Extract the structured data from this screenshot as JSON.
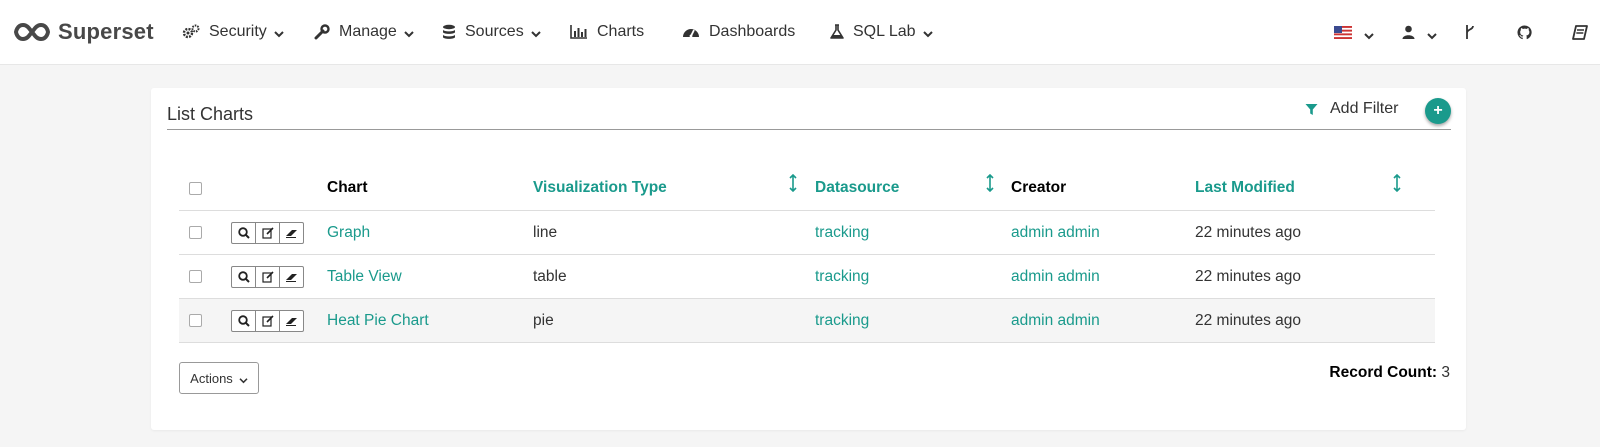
{
  "brand": {
    "name": "Superset"
  },
  "nav": {
    "items": [
      {
        "label": "Security",
        "icon": "gears-icon",
        "dropdown": true
      },
      {
        "label": "Manage",
        "icon": "wrench-icon",
        "dropdown": true
      },
      {
        "label": "Sources",
        "icon": "database-icon",
        "dropdown": true
      },
      {
        "label": "Charts",
        "icon": "bar-chart-icon",
        "dropdown": false
      },
      {
        "label": "Dashboards",
        "icon": "dashboard-icon",
        "dropdown": false
      },
      {
        "label": "SQL Lab",
        "icon": "flask-icon",
        "dropdown": true
      }
    ],
    "right": [
      "us-flag-icon",
      "user-icon",
      "version-icon",
      "github-icon",
      "book-icon"
    ]
  },
  "panel": {
    "title": "List Charts",
    "add_filter": "Add Filter",
    "add_symbol": "+"
  },
  "table": {
    "columns": {
      "chart": "Chart",
      "viz_type": "Visualization Type",
      "datasource": "Datasource",
      "creator": "Creator",
      "modified": "Last Modified"
    },
    "rows": [
      {
        "chart": "Graph",
        "viz_type": "line",
        "datasource": "tracking",
        "creator": "admin admin",
        "modified": "22 minutes ago"
      },
      {
        "chart": "Table View",
        "viz_type": "table",
        "datasource": "tracking",
        "creator": "admin admin",
        "modified": "22 minutes ago"
      },
      {
        "chart": "Heat Pie Chart",
        "viz_type": "pie",
        "datasource": "tracking",
        "creator": "admin admin",
        "modified": "22 minutes ago"
      }
    ]
  },
  "footer": {
    "actions_label": "Actions",
    "record_count_label": "Record Count:",
    "record_count": "3"
  },
  "colors": {
    "accent": "#1a9a8c",
    "text": "#333333",
    "background": "#f5f5f5"
  }
}
